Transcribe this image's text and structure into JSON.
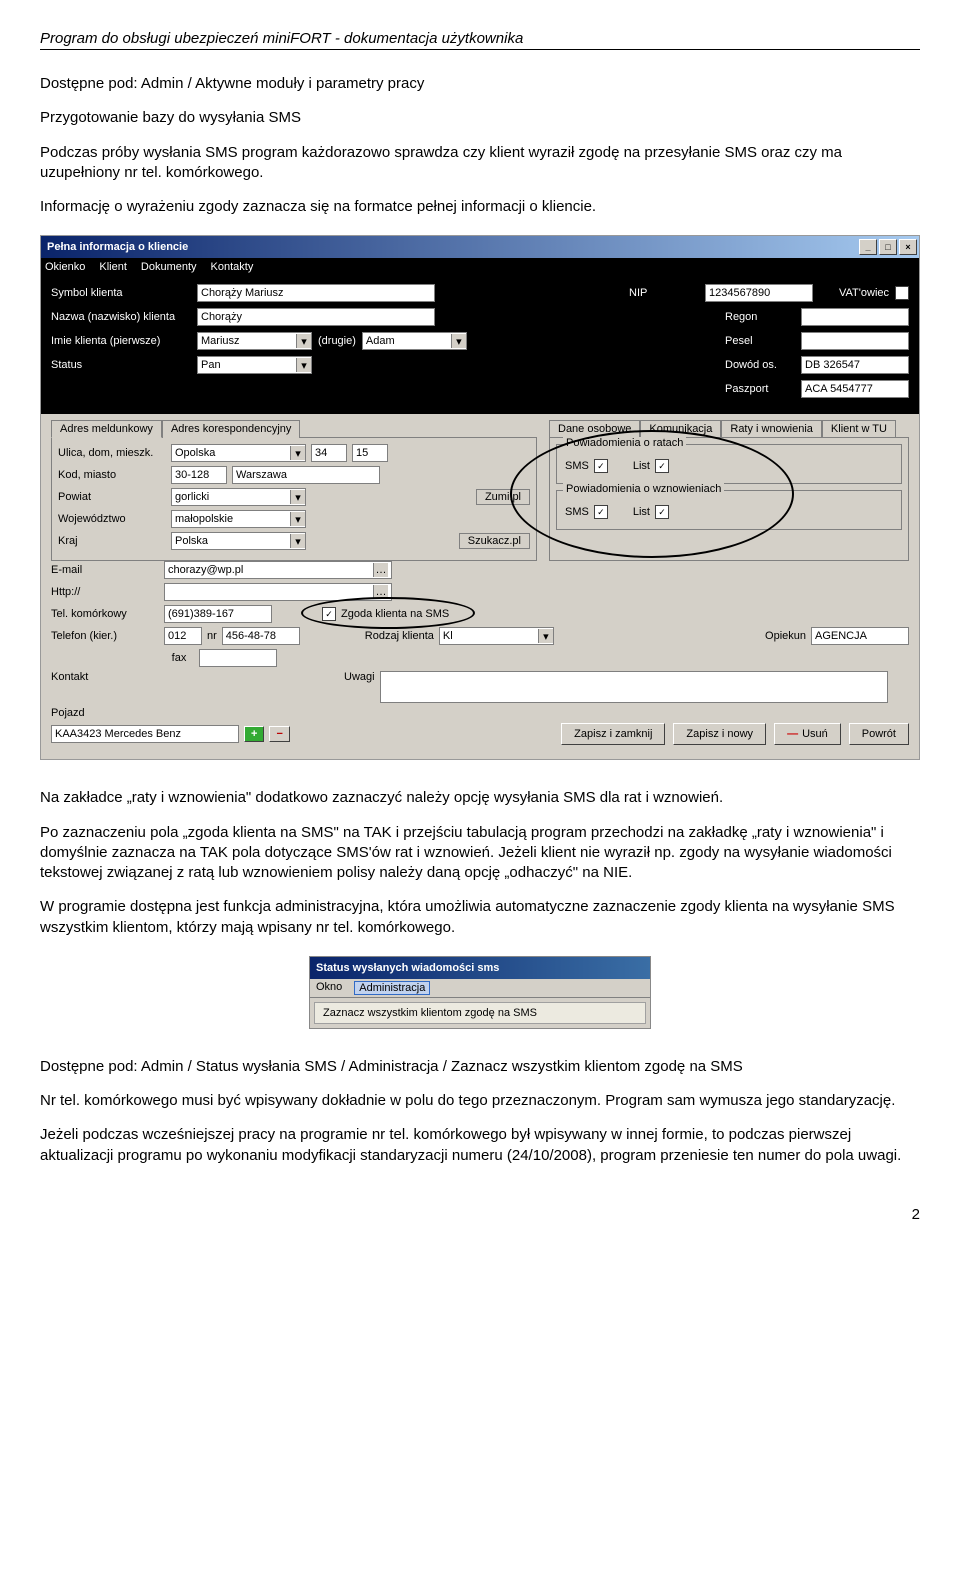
{
  "doc": {
    "header": "Program do obsługi ubezpieczeń miniFORT - dokumentacja użytkownika",
    "p1": "Dostępne pod: Admin / Aktywne moduły i parametry pracy",
    "p2": "Przygotowanie bazy do wysyłania SMS",
    "p3": "Podczas próby wysłania SMS program każdorazowo sprawdza czy klient wyraził zgodę na przesyłanie SMS oraz czy ma uzupełniony nr tel. komórkowego.",
    "p4": "Informację o wyrażeniu zgody zaznacza się na formatce pełnej informacji o kliencie.",
    "p5": "Na zakładce „raty i wznowienia\" dodatkowo zaznaczyć należy opcję wysyłania SMS dla rat i wznowień.",
    "p6": "Po zaznaczeniu pola „zgoda klienta na SMS\" na TAK i przejściu tabulacją program przechodzi na zakładkę „raty i wznowienia\" i domyślnie zaznacza na TAK pola dotyczące SMS'ów rat i wznowień. Jeżeli klient nie wyraził np. zgody na wysyłanie wiadomości tekstowej związanej z ratą lub wznowieniem polisy należy daną opcję „odhaczyć\" na NIE.",
    "p7": "W programie dostępna jest funkcja administracyjna, która umożliwia automatyczne zaznaczenie zgody klienta na wysyłanie SMS wszystkim klientom, którzy mają wpisany nr tel. komórkowego.",
    "p8": "Dostępne pod: Admin / Status wysłania SMS / Administracja / Zaznacz wszystkim klientom zgodę na SMS",
    "p9": "Nr tel. komórkowego musi być wpisywany dokładnie w polu do tego przeznaczonym. Program sam wymusza jego standaryzację.",
    "p10": "Jeżeli podczas wcześniejszej pracy na programie nr tel. komórkowego był wpisywany w innej formie, to podczas pierwszej aktualizacji programu po wykonaniu modyfikacji standaryzacji numeru (24/10/2008), program przeniesie ten numer do pola uwagi.",
    "pagenum": "2"
  },
  "win1": {
    "title": "Pełna informacja o kliencie",
    "menu": [
      "Okienko",
      "Klient",
      "Dokumenty",
      "Kontakty"
    ],
    "labels": {
      "symbol": "Symbol klienta",
      "nazwa": "Nazwa (nazwisko) klienta",
      "imie": "Imie klienta (pierwsze)",
      "drugie": "(drugie)",
      "status": "Status",
      "nip": "NIP",
      "regon": "Regon",
      "pesel": "Pesel",
      "dowod": "Dowód os.",
      "paszport": "Paszport",
      "vat": "VAT'owiec"
    },
    "vals": {
      "symbol": "Chorąży Mariusz",
      "nazwa": "Chorąży",
      "imie": "Mariusz",
      "drugie": "Adam",
      "status": "Pan",
      "nip": "1234567890",
      "dowod": "DB 326547",
      "paszport": "ACA 5454777"
    },
    "addr_tabs": [
      "Adres meldunkowy",
      "Adres korespondencyjny"
    ],
    "right_tabs": [
      "Dane osobowe",
      "Komunikacja",
      "Raty i wnowienia",
      "Klient w TU"
    ],
    "addr": {
      "ulica_l": "Ulica, dom, mieszk.",
      "ulica": "Opolska",
      "nr1": "34",
      "nr2": "15",
      "kod_l": "Kod, miasto",
      "kod": "30-128",
      "miasto": "Warszawa",
      "powiat_l": "Powiat",
      "powiat": "gorlicki",
      "woj_l": "Województwo",
      "woj": "małopolskie",
      "kraj_l": "Kraj",
      "kraj": "Polska",
      "zumi": "Zumi.pl",
      "szukacz": "Szukacz.pl"
    },
    "contacts": {
      "email_l": "E-mail",
      "email": "chorazy@wp.pl",
      "http_l": "Http://",
      "kom_l": "Tel. komórkowy",
      "kom": "(691)389-167",
      "telkier_l": "Telefon (kier.)",
      "kier": "012",
      "nr_l": "nr",
      "nr": "456-48-78",
      "fax_l": "fax",
      "zgoda": "Zgoda klienta na SMS",
      "rodzaj_l": "Rodzaj klienta",
      "rodzaj": "Kl",
      "opiekun_l": "Opiekun",
      "opiekun": "AGENCJA",
      "kontakt_l": "Kontakt",
      "uwagi_l": "Uwagi",
      "pojazd_l": "Pojazd",
      "pojazd": "KAA3423 Mercedes Benz"
    },
    "groups": {
      "raty": "Powiadomienia o ratach",
      "wznow": "Powiadomienia o wznowieniach",
      "sms": "SMS",
      "list": "List"
    },
    "buttons": {
      "zapisz_zamknij": "Zapisz i zamknij",
      "zapisz_nowy": "Zapisz i nowy",
      "usun": "Usuń",
      "powrot": "Powrót"
    }
  },
  "win2": {
    "title": "Status wysłanych wiadomości sms",
    "menu": [
      "Okno",
      "Administracja"
    ],
    "item": "Zaznacz wszystkim klientom zgodę na SMS"
  }
}
